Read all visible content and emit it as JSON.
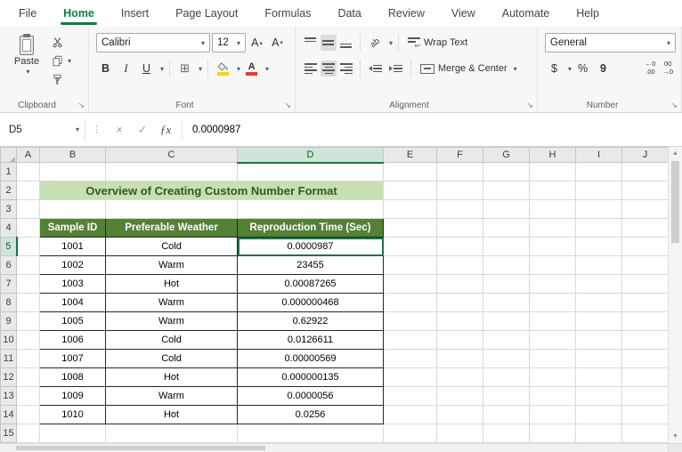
{
  "icons": {
    "dropdown": "▾",
    "dropup": "▴",
    "cancel": "×",
    "enter": "✓",
    "fx": "ƒx",
    "launcher": "↘",
    "splitter": "⋮",
    "select_all": "◢",
    "scroll_up": "▲",
    "scroll_down": "▼",
    "return_arrow": "↩",
    "bold": "B",
    "italic": "I",
    "underline": "U",
    "letter_a": "A",
    "borders_glyph": "⊞",
    "orientation_glyph": "ab"
  },
  "ribbon": {
    "tabs": [
      {
        "label": "File"
      },
      {
        "label": "Home",
        "active": true
      },
      {
        "label": "Insert"
      },
      {
        "label": "Page Layout"
      },
      {
        "label": "Formulas"
      },
      {
        "label": "Data"
      },
      {
        "label": "Review"
      },
      {
        "label": "View"
      },
      {
        "label": "Automate"
      },
      {
        "label": "Help"
      }
    ],
    "groups": {
      "clipboard": "Clipboard",
      "font": "Font",
      "alignment": "Alignment",
      "number": "Number"
    },
    "clipboard": {
      "paste_label": "Paste"
    },
    "font": {
      "font_name": "Calibri",
      "font_size": "12"
    },
    "alignment": {
      "wrap_text": "Wrap Text",
      "merge_center": "Merge & Center"
    },
    "number": {
      "format": "General",
      "currency": "$",
      "percent": "%",
      "comma": "9",
      "inc_decimal_top": "←0",
      "inc_decimal_bottom": ".00",
      "dec_decimal_top": "00",
      "dec_decimal_bottom": "→0"
    }
  },
  "formula_bar": {
    "name_box": "D5",
    "content": "0.0000987"
  },
  "sheet": {
    "columns": [
      "A",
      "B",
      "C",
      "D",
      "E",
      "F",
      "G",
      "H",
      "I",
      "J"
    ],
    "row_count": 15,
    "selection": {
      "col": "D",
      "row": 5
    },
    "title_banner": {
      "row": 2,
      "start_col": "B",
      "span": 3,
      "text": "Overview of Creating Custom Number Format"
    },
    "table": {
      "header_row": 4,
      "data_start_row": 5,
      "headers": [
        "Sample ID",
        "Preferable Weather",
        "Reproduction Time (Sec)"
      ],
      "rows": [
        [
          "1001",
          "Cold",
          "0.0000987"
        ],
        [
          "1002",
          "Warm",
          "23455"
        ],
        [
          "1003",
          "Hot",
          "0.00087265"
        ],
        [
          "1004",
          "Warm",
          "0.000000468"
        ],
        [
          "1005",
          "Warm",
          "0.62922"
        ],
        [
          "1006",
          "Cold",
          "0.0126611"
        ],
        [
          "1007",
          "Cold",
          "0.00000569"
        ],
        [
          "1008",
          "Hot",
          "0.000000135"
        ],
        [
          "1009",
          "Warm",
          "0.0000056"
        ],
        [
          "1010",
          "Hot",
          "0.0256"
        ]
      ]
    }
  },
  "colors": {
    "accent_green": "#107C41",
    "table_header_bg": "#538135",
    "banner_bg": "#C6E0B4",
    "banner_text": "#375623",
    "selection_border": "#1E7145",
    "fill_color_bar": "#F7D308",
    "font_color_bar": "#E03C31"
  }
}
